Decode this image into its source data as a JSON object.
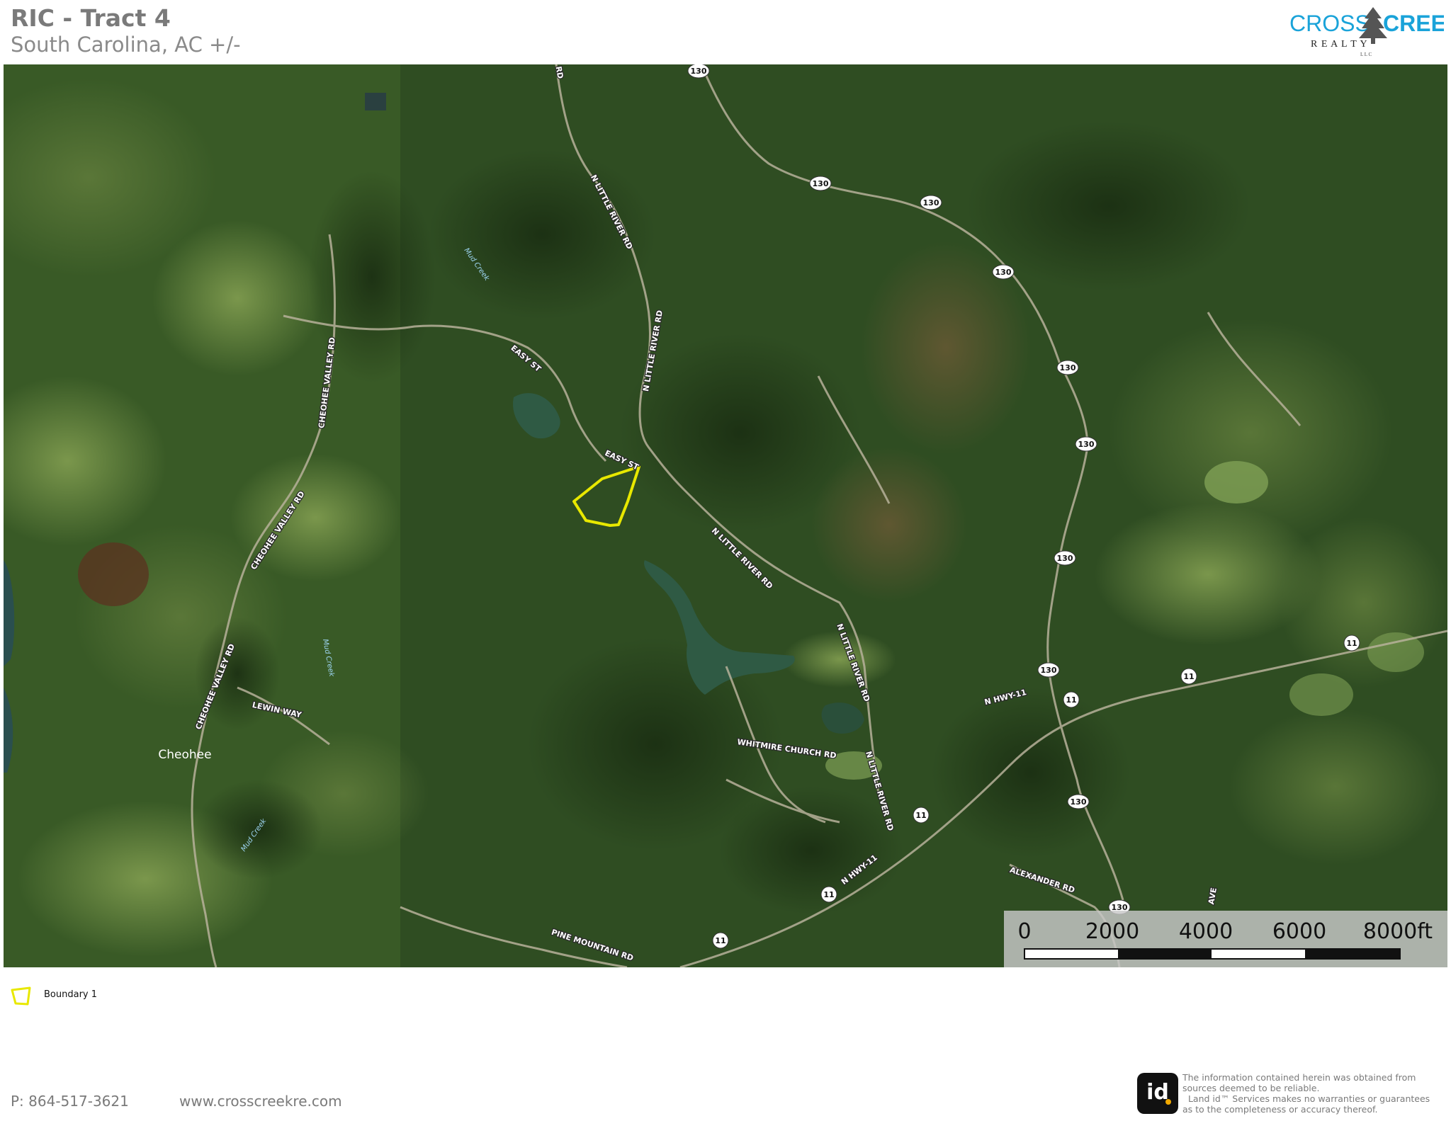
{
  "header": {
    "title": "RIC - Tract 4",
    "subtitle": "South Carolina,  AC +/-"
  },
  "logo": {
    "word_left": "CROSS",
    "word_right": "CREEK",
    "tagline": "R E A L T Y",
    "small": "L L C"
  },
  "map": {
    "places": [
      "Cheohee"
    ],
    "water_labels": [
      "Mud Creek",
      "Mud Creek",
      "Mud Creek"
    ],
    "roads": [
      "RD",
      "N LITTLE RIVER RD",
      "N LITTLE RIVER RD",
      "N LITTLE RIVER RD",
      "N LITTLE RIVER RD",
      "N LITTLE RIVER RD",
      "CHEOHEE VALLEY RD",
      "CHEOHEE VALLEY RD",
      "CHEOHEE VALLEY RD",
      "EASY ST",
      "EASY ST",
      "LEWIN WAY",
      "WHITMIRE CHURCH RD",
      "N HWY-11",
      "N HWY-11",
      "ALEXANDER RD",
      "PINE MOUNTAIN RD",
      "AVE"
    ],
    "route_shields": [
      "130",
      "130",
      "130",
      "130",
      "130",
      "130",
      "130",
      "130",
      "130",
      "130",
      "11",
      "11",
      "11",
      "11",
      "11",
      "11"
    ]
  },
  "scale": {
    "labels": [
      "0",
      "2000",
      "4000",
      "6000",
      "8000ft"
    ]
  },
  "legend": {
    "label": "Boundary 1",
    "color": "#e8e800"
  },
  "footer": {
    "phone": "P: 864-517-3621",
    "website": "www.crosscreekre.com",
    "id_logo": "id",
    "disclaimer": [
      "The information contained herein was obtained from",
      "sources deemed to be reliable.",
      "  Land id™ Services makes no warranties or guarantees",
      "as to the completeness or accuracy thereof."
    ]
  },
  "colors": {
    "forest": "#2c4a1f",
    "boundary": "#e8e800",
    "brand_blue": "#1aa3d9"
  }
}
